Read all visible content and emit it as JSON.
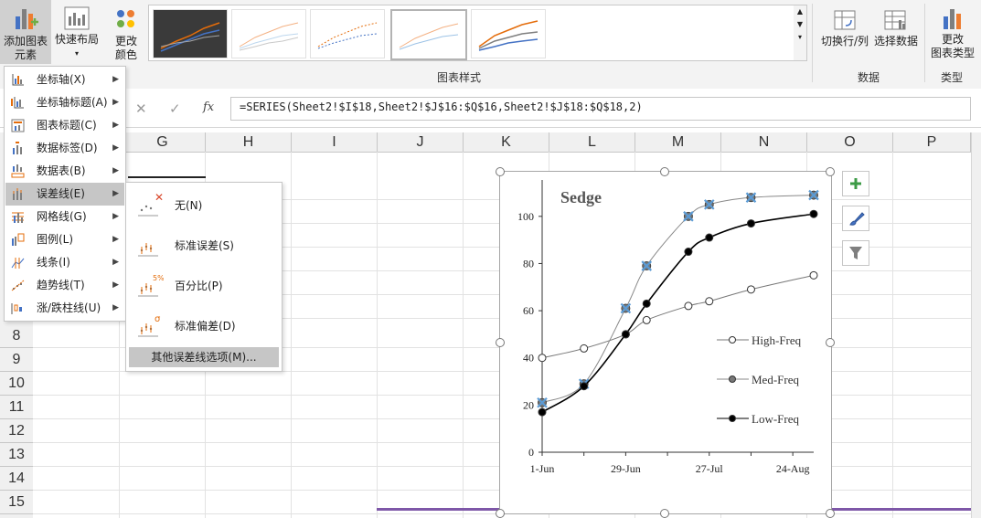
{
  "ribbon": {
    "add_chart_element": "添加图表\n元素",
    "quick_layout": "快速布局",
    "change_colors": "更改\n颜色",
    "chart_styles_group": "图表样式",
    "switch_row_col": "切换行/列",
    "select_data": "选择数据",
    "data_group": "数据",
    "change_chart_type": "更改\n图表类型",
    "type_group": "类型"
  },
  "formula": {
    "cancel": "✕",
    "enter": "✓",
    "fx": "fx",
    "text": "=SERIES(Sheet2!$I$18,Sheet2!$J$16:$Q$16,Sheet2!$J$18:$Q$18,2)"
  },
  "columns": [
    "G",
    "H",
    "I",
    "J",
    "K",
    "L",
    "M",
    "N",
    "O",
    "P"
  ],
  "rows": [
    "8",
    "9",
    "10",
    "11",
    "12",
    "13",
    "14",
    "15"
  ],
  "menu": {
    "items": [
      {
        "label": "坐标轴(X)",
        "icon": "axis-icon"
      },
      {
        "label": "坐标轴标题(A)",
        "icon": "axis-title-icon"
      },
      {
        "label": "图表标题(C)",
        "icon": "chart-title-icon"
      },
      {
        "label": "数据标签(D)",
        "icon": "data-labels-icon"
      },
      {
        "label": "数据表(B)",
        "icon": "data-table-icon"
      },
      {
        "label": "误差线(E)",
        "icon": "error-bars-icon"
      },
      {
        "label": "网格线(G)",
        "icon": "gridlines-icon"
      },
      {
        "label": "图例(L)",
        "icon": "legend-icon"
      },
      {
        "label": "线条(I)",
        "icon": "lines-icon"
      },
      {
        "label": "趋势线(T)",
        "icon": "trendline-icon"
      },
      {
        "label": "涨/跌柱线(U)",
        "icon": "up-down-bars-icon"
      }
    ],
    "active_index": 5
  },
  "submenu": {
    "items": [
      {
        "label": "无(N)",
        "icon": "no-error-bars-icon",
        "badge": "✕"
      },
      {
        "label": "标准误差(S)",
        "icon": "standard-error-icon",
        "badge": ""
      },
      {
        "label": "百分比(P)",
        "icon": "percentage-icon",
        "badge": "5%"
      },
      {
        "label": "标准偏差(D)",
        "icon": "standard-deviation-icon",
        "badge": "σ"
      }
    ],
    "more": "其他误差线选项(M)..."
  },
  "colors": {
    "accent_orange": "#e46c0a",
    "selection_blue": "#5b9bd5",
    "ribbon_bg": "#f3f3f3"
  },
  "chart_data": {
    "type": "line",
    "title": "Sedge",
    "x": [
      "1-Jun",
      "15-Jun",
      "29-Jun",
      "6-Jul",
      "20-Jul",
      "27-Jul",
      "10-Aug",
      "31-Aug"
    ],
    "x_days": [
      0,
      14,
      28,
      35,
      49,
      56,
      70,
      91
    ],
    "xticks": [
      "1-Jun",
      "29-Jun",
      "27-Jul",
      "24-Aug"
    ],
    "xtick_days": [
      0,
      28,
      56,
      84
    ],
    "ylim": [
      0,
      110
    ],
    "yticks": [
      0,
      20,
      40,
      60,
      80,
      100
    ],
    "series": [
      {
        "name": "High-Freq",
        "values": [
          40,
          44,
          50,
          56,
          62,
          64,
          69,
          75
        ],
        "marker": "open"
      },
      {
        "name": "Med-Freq",
        "values": [
          21,
          29,
          61,
          79,
          100,
          105,
          108,
          109
        ],
        "marker": "gray",
        "selected": true
      },
      {
        "name": "Low-Freq",
        "values": [
          17,
          28,
          50,
          63,
          85,
          91,
          97,
          101
        ],
        "marker": "filled"
      }
    ],
    "legend_position": "right"
  }
}
